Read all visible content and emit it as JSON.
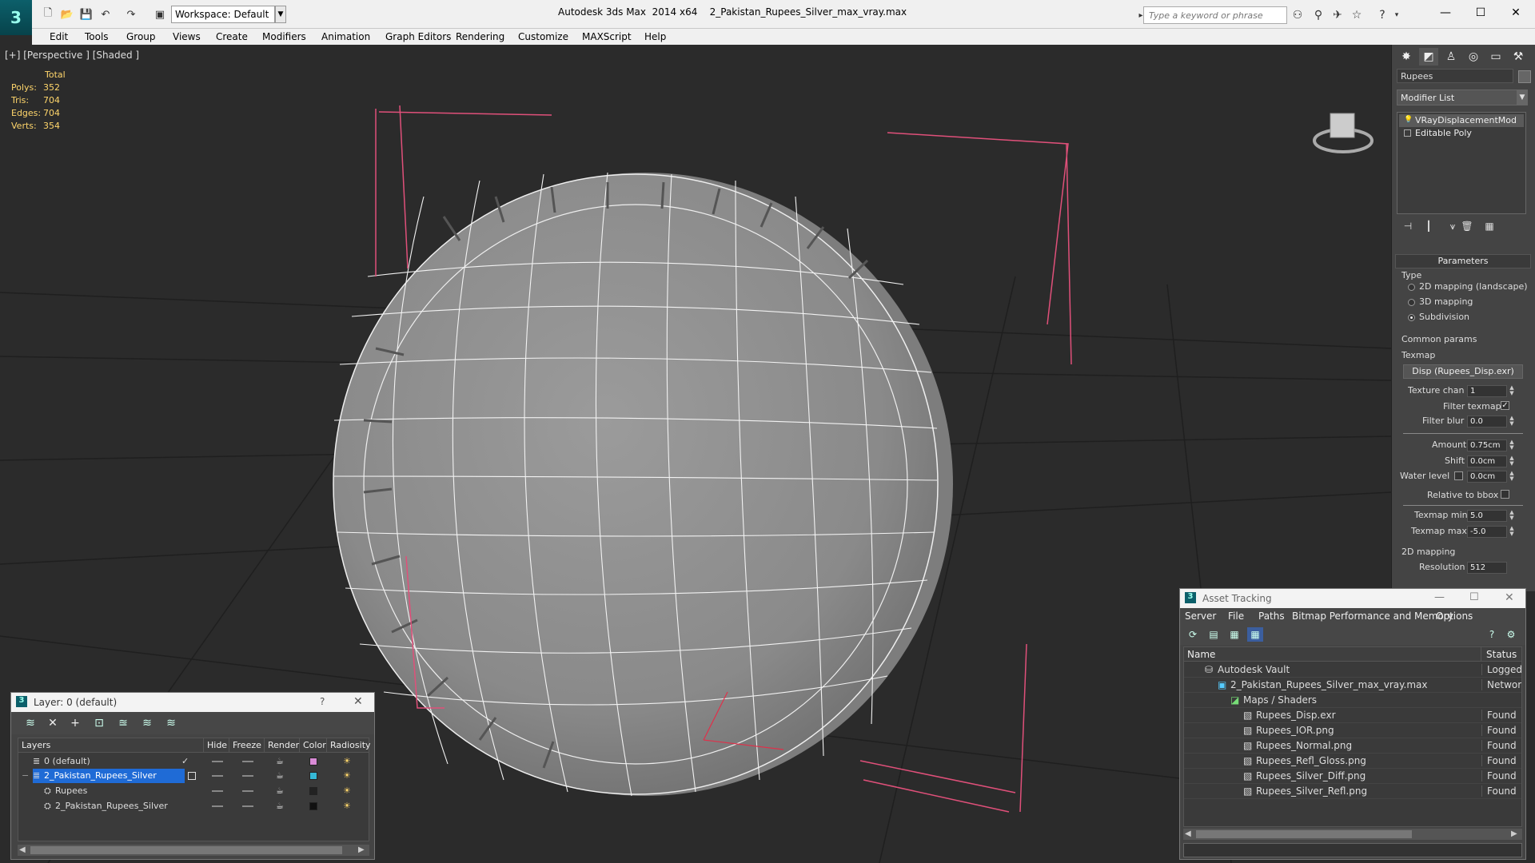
{
  "titlebar": {
    "workspace": "Workspace: Default",
    "app_title": "Autodesk 3ds Max  2014 x64",
    "file_title": "2_Pakistan_Rupees_Silver_max_vray.max",
    "search_placeholder": "Type a keyword or phrase"
  },
  "menu": [
    "Edit",
    "Tools",
    "Group",
    "Views",
    "Create",
    "Modifiers",
    "Animation",
    "Graph Editors",
    "Rendering",
    "Customize",
    "MAXScript",
    "Help"
  ],
  "viewport": {
    "label": "[+] [Perspective ] [Shaded ]",
    "stats": {
      "header": "Total",
      "rows": [
        {
          "label": "Polys:",
          "value": "352"
        },
        {
          "label": "Tris:",
          "value": "704"
        },
        {
          "label": "Edges:",
          "value": "704"
        },
        {
          "label": "Verts:",
          "value": "354"
        }
      ]
    }
  },
  "command_panel": {
    "object_name": "Rupees",
    "modifier_list": "Modifier List",
    "stack": [
      "VRayDisplacementMod",
      "Editable Poly"
    ],
    "params_title": "Parameters",
    "type_label": "Type",
    "type_options": [
      {
        "label": "2D mapping (landscape)",
        "selected": false
      },
      {
        "label": "3D mapping",
        "selected": false
      },
      {
        "label": "Subdivision",
        "selected": true
      }
    ],
    "common_label": "Common params",
    "texmap_label": "Texmap",
    "texmap_button": "Disp (Rupees_Disp.exr)",
    "texture_chan_label": "Texture chan",
    "texture_chan": "1",
    "filter_texmap_label": "Filter texmap",
    "filter_blur_label": "Filter blur",
    "filter_blur": "0.0",
    "amount_label": "Amount",
    "amount": "0.75cm",
    "shift_label": "Shift",
    "shift": "0.0cm",
    "water_level_label": "Water level",
    "water_level": "0.0cm",
    "relative_bbox_label": "Relative to bbox",
    "texmap_min_label": "Texmap min",
    "texmap_min": "5.0",
    "texmap_max_label": "Texmap max",
    "texmap_max": "-5.0",
    "mapping_2d_label": "2D mapping",
    "resolution_label": "Resolution",
    "resolution": "512"
  },
  "layer_window": {
    "title": "Layer: 0 (default)",
    "help": "?",
    "columns": [
      "Layers",
      "Hide",
      "Freeze",
      "Render",
      "Color",
      "Radiosity"
    ],
    "rows": [
      {
        "name": "0 (default)",
        "indent": 1,
        "color": "#d98bd6"
      },
      {
        "name": "2_Pakistan_Rupees_Silver",
        "indent": 1,
        "color": "#35b8d6"
      },
      {
        "name": "Rupees",
        "indent": 2,
        "color": "#222222"
      },
      {
        "name": "2_Pakistan_Rupees_Silver",
        "indent": 2,
        "color": "#111111"
      }
    ]
  },
  "asset_window": {
    "title": "Asset Tracking",
    "menu": [
      "Server",
      "File",
      "Paths",
      "Bitmap Performance and Memory",
      "Options"
    ],
    "columns": [
      "Name",
      "Status"
    ],
    "rows": [
      {
        "name": "Autodesk Vault",
        "indent": 1,
        "status": "Logged O"
      },
      {
        "name": "2_Pakistan_Rupees_Silver_max_vray.max",
        "indent": 2,
        "status": "Network"
      },
      {
        "name": "Maps / Shaders",
        "indent": 3,
        "status": ""
      },
      {
        "name": "Rupees_Disp.exr",
        "indent": 4,
        "status": "Found"
      },
      {
        "name": "Rupees_IOR.png",
        "indent": 4,
        "status": "Found"
      },
      {
        "name": "Rupees_Normal.png",
        "indent": 4,
        "status": "Found"
      },
      {
        "name": "Rupees_Refl_Gloss.png",
        "indent": 4,
        "status": "Found"
      },
      {
        "name": "Rupees_Silver_Diff.png",
        "indent": 4,
        "status": "Found"
      },
      {
        "name": "Rupees_Silver_Refl.png",
        "indent": 4,
        "status": "Found"
      }
    ]
  },
  "colors": {
    "accent": "#0c5f6a",
    "stats_text": "#ffd66b",
    "selection": "#1f6bd6",
    "bbox": "#e0507a"
  }
}
